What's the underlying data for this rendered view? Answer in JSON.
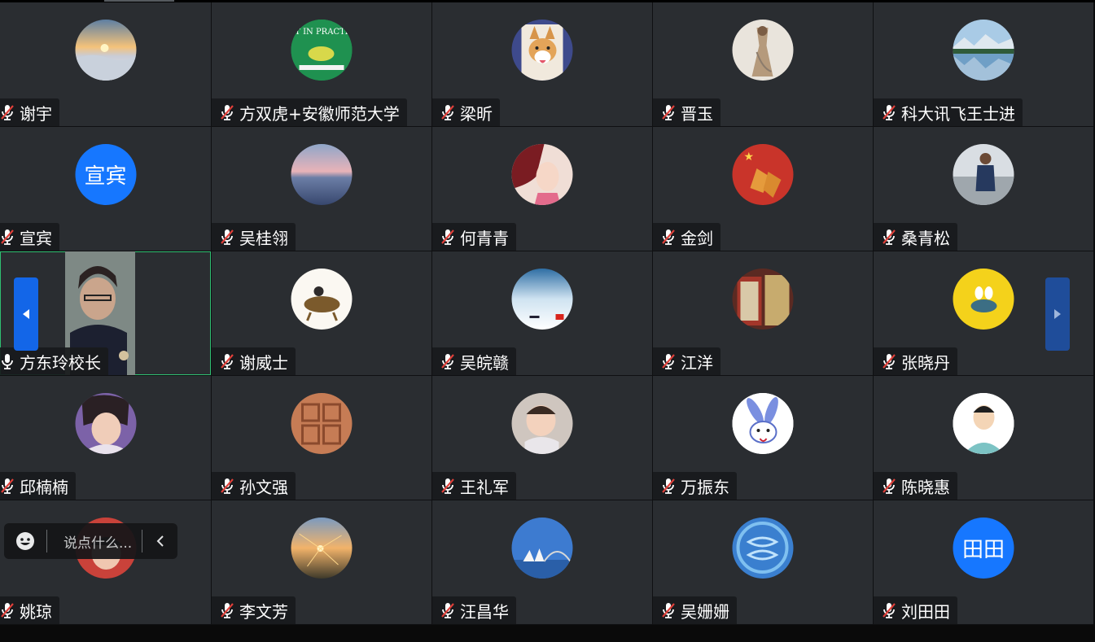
{
  "participants": [
    {
      "name": "谢宇",
      "mic": "muted"
    },
    {
      "name": "方双虎+安徽师范大学",
      "mic": "muted",
      "avatar_text": "ACT IN PRACTICE"
    },
    {
      "name": "梁昕",
      "mic": "muted"
    },
    {
      "name": "晋玉",
      "mic": "muted"
    },
    {
      "name": "科大讯飞王士进",
      "mic": "muted"
    },
    {
      "name": "宣宾",
      "mic": "muted",
      "avatar_text": "宣宾"
    },
    {
      "name": "吴桂翎",
      "mic": "muted"
    },
    {
      "name": "何青青",
      "mic": "muted"
    },
    {
      "name": "金剑",
      "mic": "muted"
    },
    {
      "name": "桑青松",
      "mic": "muted"
    },
    {
      "name": "方东玲校长",
      "mic": "on",
      "video": true
    },
    {
      "name": "谢威士",
      "mic": "muted"
    },
    {
      "name": "吴皖赣",
      "mic": "muted"
    },
    {
      "name": "江洋",
      "mic": "muted"
    },
    {
      "name": "张晓丹",
      "mic": "muted"
    },
    {
      "name": "邱楠楠",
      "mic": "muted"
    },
    {
      "name": "孙文强",
      "mic": "muted"
    },
    {
      "name": "王礼军",
      "mic": "muted"
    },
    {
      "name": "万振东",
      "mic": "muted"
    },
    {
      "name": "陈晓惠",
      "mic": "muted"
    },
    {
      "name": "姚琼",
      "mic": "muted"
    },
    {
      "name": "李文芳",
      "mic": "muted"
    },
    {
      "name": "汪昌华",
      "mic": "muted"
    },
    {
      "name": "吴姗姗",
      "mic": "muted"
    },
    {
      "name": "刘田田",
      "mic": "muted",
      "avatar_text": "田田"
    }
  ],
  "chat": {
    "placeholder": "说点什么..."
  },
  "colors": {
    "accent": "#1677ff",
    "muted_slash": "#e0403a",
    "tile_bg": "#2a2d31",
    "speaker_border": "#2fbf71"
  }
}
